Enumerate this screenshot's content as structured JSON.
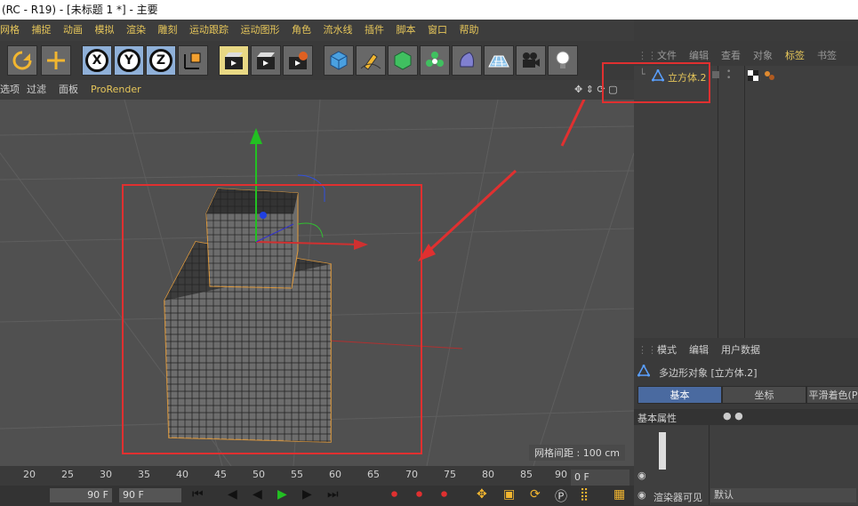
{
  "title": "(RC - R19) - [未标题 1 *] - 主要",
  "menu": [
    "网格",
    "捕捉",
    "动画",
    "模拟",
    "渲染",
    "雕刻",
    "运动跟踪",
    "运动图形",
    "角色",
    "流水线",
    "插件",
    "脚本",
    "窗口",
    "帮助"
  ],
  "viewport_tabs": [
    "选项",
    "过滤",
    "面板",
    "ProRender"
  ],
  "grid_spacing": "网格间距 : 100 cm",
  "object_manager": {
    "tabs": [
      "文件",
      "编辑",
      "查看",
      "对象",
      "标签",
      "书签"
    ],
    "object_name": "立方体.2"
  },
  "attribute_manager": {
    "tabs": [
      "模式",
      "编辑",
      "用户数据"
    ],
    "object_title": "多边形对象 [立方体.2]",
    "sub_tabs": [
      "基本",
      "坐标",
      "平滑着色(P"
    ],
    "section": "基本属性",
    "render_visible_label": "渲染器可见",
    "render_visible_value": "默认"
  },
  "timeline": {
    "ticks": [
      "20",
      "25",
      "30",
      "35",
      "40",
      "45",
      "50",
      "55",
      "60",
      "65",
      "70",
      "75",
      "80",
      "85",
      "90"
    ],
    "frame_field": "0 F",
    "start_field": "90 F",
    "end_field": "90 F"
  },
  "colors": {
    "accent": "#e8c454",
    "highlight_box": "#e03030",
    "selected_tab": "#e8d884"
  }
}
